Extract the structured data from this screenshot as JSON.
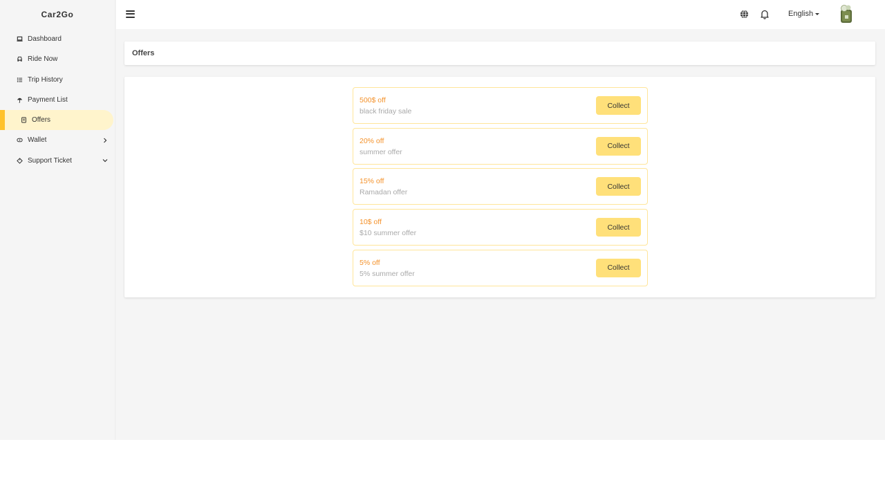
{
  "app": {
    "brand": "Car2Go"
  },
  "sidebar": {
    "items": [
      {
        "label": "Dashboard",
        "icon": "laptop-icon"
      },
      {
        "label": "Ride Now",
        "icon": "car-icon"
      },
      {
        "label": "Trip History",
        "icon": "list-icon"
      },
      {
        "label": "Payment List",
        "icon": "umbrella-icon"
      },
      {
        "label": "Offers",
        "icon": "receipt-icon",
        "active": true
      },
      {
        "label": "Wallet",
        "icon": "wallet-icon",
        "arrow": "chevron-right-icon"
      },
      {
        "label": "Support Ticket",
        "icon": "tag-icon",
        "arrow": "chevron-down-icon"
      }
    ]
  },
  "topbar": {
    "language": "English",
    "icons": [
      "menu-icon",
      "globe-icon",
      "bell-icon"
    ]
  },
  "page": {
    "title": "Offers"
  },
  "offers": [
    {
      "title": "500$ off",
      "desc": "black friday sale",
      "button": "Collect"
    },
    {
      "title": "20% off",
      "desc": "summer offer",
      "button": "Collect"
    },
    {
      "title": "15% off",
      "desc": "Ramadan offer",
      "button": "Collect"
    },
    {
      "title": "10$ off",
      "desc": "$10 summer offer",
      "button": "Collect"
    },
    {
      "title": "5% off",
      "desc": "5% summer offer",
      "button": "Collect"
    }
  ],
  "colors": {
    "accent": "#ffc22b",
    "active_bg": "#fff4cc",
    "offer_title": "#f4922b",
    "button_bg": "#ffe07a",
    "offer_border": "#ffe599"
  }
}
